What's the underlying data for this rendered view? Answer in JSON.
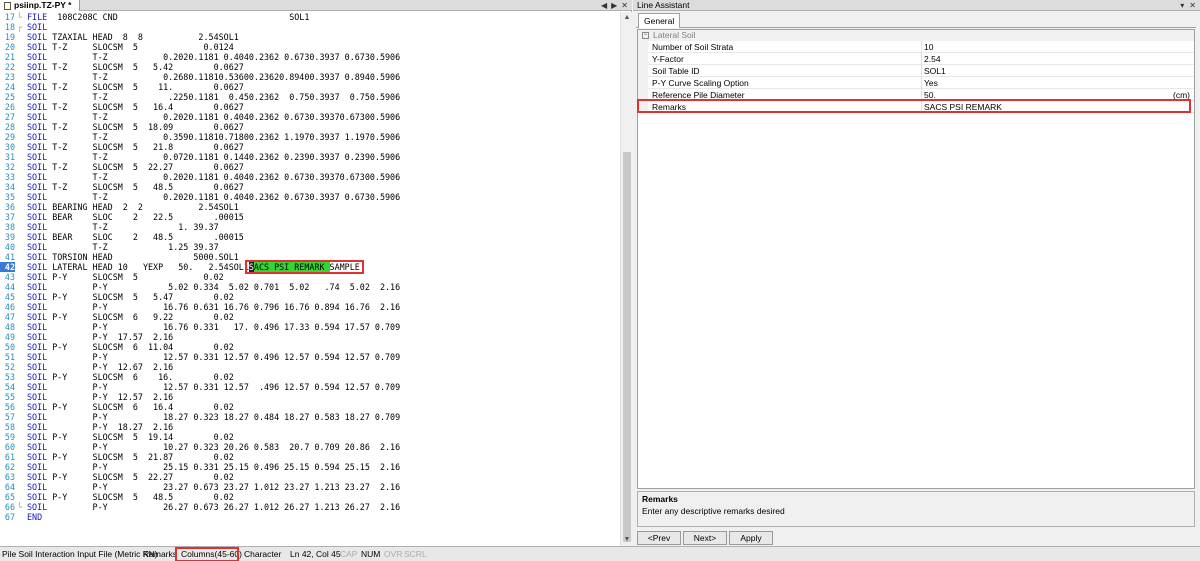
{
  "editor": {
    "tab_title": "psiinp.TZ-PY *",
    "tabbar_icons": [
      "◀",
      "▶",
      "✕"
    ],
    "lines": [
      {
        "n": "17",
        "fold": "└",
        "kw": "FILE",
        "rest": "  108C208C CND                                  SOL1"
      },
      {
        "n": "18",
        "fold": "┌",
        "kw": "SOIL",
        "rest": ""
      },
      {
        "n": "19",
        "fold": "",
        "kw": "SOIL",
        "rest": " TZAXIAL HEAD  8  8           2.54SOL1"
      },
      {
        "n": "20",
        "fold": "",
        "kw": "SOIL",
        "rest": " T-Z     SLOCSM  5             0.0124"
      },
      {
        "n": "21",
        "fold": "",
        "kw": "SOIL",
        "rest": "         T-Z           0.2020.1181 0.4040.2362 0.6730.3937 0.6730.5906"
      },
      {
        "n": "22",
        "fold": "",
        "kw": "SOIL",
        "rest": " T-Z     SLOCSM  5   5.42        0.0627"
      },
      {
        "n": "23",
        "fold": "",
        "kw": "SOIL",
        "rest": "         T-Z           0.2680.11810.53600.23620.89400.3937 0.8940.5906"
      },
      {
        "n": "24",
        "fold": "",
        "kw": "SOIL",
        "rest": " T-Z     SLOCSM  5    11.        0.0627"
      },
      {
        "n": "25",
        "fold": "",
        "kw": "SOIL",
        "rest": "         T-Z            .2250.1181  0.450.2362  0.750.3937  0.750.5906"
      },
      {
        "n": "26",
        "fold": "",
        "kw": "SOIL",
        "rest": " T-Z     SLOCSM  5   16.4        0.0627"
      },
      {
        "n": "27",
        "fold": "",
        "kw": "SOIL",
        "rest": "         T-Z           0.2020.1181 0.4040.2362 0.6730.39370.67300.5906"
      },
      {
        "n": "28",
        "fold": "",
        "kw": "SOIL",
        "rest": " T-Z     SLOCSM  5  18.09        0.0627"
      },
      {
        "n": "29",
        "fold": "",
        "kw": "SOIL",
        "rest": "         T-Z           0.3590.11810.71800.2362 1.1970.3937 1.1970.5906"
      },
      {
        "n": "30",
        "fold": "",
        "kw": "SOIL",
        "rest": " T-Z     SLOCSM  5   21.8        0.0627"
      },
      {
        "n": "31",
        "fold": "",
        "kw": "SOIL",
        "rest": "         T-Z           0.0720.1181 0.1440.2362 0.2390.3937 0.2390.5906"
      },
      {
        "n": "32",
        "fold": "",
        "kw": "SOIL",
        "rest": " T-Z     SLOCSM  5  22.27        0.0627"
      },
      {
        "n": "33",
        "fold": "",
        "kw": "SOIL",
        "rest": "         T-Z           0.2020.1181 0.4040.2362 0.6730.39370.67300.5906"
      },
      {
        "n": "34",
        "fold": "",
        "kw": "SOIL",
        "rest": " T-Z     SLOCSM  5   48.5        0.0627"
      },
      {
        "n": "35",
        "fold": "",
        "kw": "SOIL",
        "rest": "         T-Z           0.2020.1181 0.4040.2362 0.6730.3937 0.6730.5906"
      },
      {
        "n": "36",
        "fold": "",
        "kw": "SOIL",
        "rest": " BEARING HEAD  2  2           2.54SOL1"
      },
      {
        "n": "37",
        "fold": "",
        "kw": "SOIL",
        "rest": " BEAR    SLOC    2   22.5        .00015"
      },
      {
        "n": "38",
        "fold": "",
        "kw": "SOIL",
        "rest": "         T-Z              1. 39.37"
      },
      {
        "n": "39",
        "fold": "",
        "kw": "SOIL",
        "rest": " BEAR    SLOC    2   48.5        .00015"
      },
      {
        "n": "40",
        "fold": "",
        "kw": "SOIL",
        "rest": "         T-Z            1.25 39.37"
      },
      {
        "n": "41",
        "fold": "",
        "kw": "SOIL",
        "rest": " TORSION HEAD                5000.SOL1"
      },
      {
        "n": "42",
        "fold": "",
        "kw": "SOIL",
        "rest": " LATERAL HEAD 10   YEXP   50.   2.54SOL1",
        "current": true,
        "cursor": "S",
        "highlight": "ACS PSI REMARK ",
        "after": "SAMPLE"
      },
      {
        "n": "43",
        "fold": "",
        "kw": "SOIL",
        "rest": " P-Y     SLOCSM  5             0.02"
      },
      {
        "n": "44",
        "fold": "",
        "kw": "SOIL",
        "rest": "         P-Y            5.02 0.334  5.02 0.701  5.02   .74  5.02  2.16"
      },
      {
        "n": "45",
        "fold": "",
        "kw": "SOIL",
        "rest": " P-Y     SLOCSM  5   5.47        0.02"
      },
      {
        "n": "46",
        "fold": "",
        "kw": "SOIL",
        "rest": "         P-Y           16.76 0.631 16.76 0.796 16.76 0.894 16.76  2.16"
      },
      {
        "n": "47",
        "fold": "",
        "kw": "SOIL",
        "rest": " P-Y     SLOCSM  6   9.22        0.02"
      },
      {
        "n": "48",
        "fold": "",
        "kw": "SOIL",
        "rest": "         P-Y           16.76 0.331   17. 0.496 17.33 0.594 17.57 0.709"
      },
      {
        "n": "49",
        "fold": "",
        "kw": "SOIL",
        "rest": "         P-Y  17.57  2.16"
      },
      {
        "n": "50",
        "fold": "",
        "kw": "SOIL",
        "rest": " P-Y     SLOCSM  6  11.04        0.02"
      },
      {
        "n": "51",
        "fold": "",
        "kw": "SOIL",
        "rest": "         P-Y           12.57 0.331 12.57 0.496 12.57 0.594 12.57 0.709"
      },
      {
        "n": "52",
        "fold": "",
        "kw": "SOIL",
        "rest": "         P-Y  12.67  2.16"
      },
      {
        "n": "53",
        "fold": "",
        "kw": "SOIL",
        "rest": " P-Y     SLOCSM  6    16.        0.02"
      },
      {
        "n": "54",
        "fold": "",
        "kw": "SOIL",
        "rest": "         P-Y           12.57 0.331 12.57  .496 12.57 0.594 12.57 0.709"
      },
      {
        "n": "55",
        "fold": "",
        "kw": "SOIL",
        "rest": "         P-Y  12.57  2.16"
      },
      {
        "n": "56",
        "fold": "",
        "kw": "SOIL",
        "rest": " P-Y     SLOCSM  6   16.4        0.02"
      },
      {
        "n": "57",
        "fold": "",
        "kw": "SOIL",
        "rest": "         P-Y           18.27 0.323 18.27 0.484 18.27 0.583 18.27 0.709"
      },
      {
        "n": "58",
        "fold": "",
        "kw": "SOIL",
        "rest": "         P-Y  18.27  2.16"
      },
      {
        "n": "59",
        "fold": "",
        "kw": "SOIL",
        "rest": " P-Y     SLOCSM  5  19.14        0.02"
      },
      {
        "n": "60",
        "fold": "",
        "kw": "SOIL",
        "rest": "         P-Y           10.27 0.323 20.26 0.583  20.7 0.709 20.86  2.16"
      },
      {
        "n": "61",
        "fold": "",
        "kw": "SOIL",
        "rest": " P-Y     SLOCSM  5  21.87        0.02"
      },
      {
        "n": "62",
        "fold": "",
        "kw": "SOIL",
        "rest": "         P-Y           25.15 0.331 25.15 0.496 25.15 0.594 25.15  2.16"
      },
      {
        "n": "63",
        "fold": "",
        "kw": "SOIL",
        "rest": " P-Y     SLOCSM  5  22.27        0.02"
      },
      {
        "n": "64",
        "fold": "",
        "kw": "SOIL",
        "rest": "         P-Y           23.27 0.673 23.27 1.012 23.27 1.213 23.27  2.16"
      },
      {
        "n": "65",
        "fold": "",
        "kw": "SOIL",
        "rest": " P-Y     SLOCSM  5   48.5        0.02"
      },
      {
        "n": "66",
        "fold": "└",
        "kw": "SOIL",
        "rest": "         P-Y           26.27 0.673 26.27 1.012 26.27 1.213 26.27  2.16"
      },
      {
        "n": "67",
        "fold": "",
        "kw": "END",
        "rest": ""
      }
    ]
  },
  "line_assistant": {
    "title": "Line Assistant",
    "header_icons": [
      "▾",
      "✕"
    ],
    "tab_general": "General",
    "category": "Lateral Soil",
    "category_expander": "−",
    "properties": [
      {
        "name": "Number of Soil Strata",
        "value": "10",
        "unit": ""
      },
      {
        "name": "Y-Factor",
        "value": "2.54",
        "unit": ""
      },
      {
        "name": "Soil Table ID",
        "value": "SOL1",
        "unit": ""
      },
      {
        "name": "P-Y Curve Scaling Option",
        "value": "Yes",
        "unit": ""
      },
      {
        "name": "Reference Pile Diameter",
        "value": "50.",
        "unit": "(cm)"
      },
      {
        "name": "Remarks",
        "value": "SACS PSI REMARK",
        "unit": ""
      }
    ],
    "description": {
      "title": "Remarks",
      "text": "Enter any descriptive remarks desired"
    },
    "buttons": {
      "prev": "<Prev",
      "next": "Next>",
      "apply": "Apply"
    }
  },
  "status_bar": {
    "file_type": "Pile Soil Interaction Input File (Metric KN)",
    "field": "Remarks",
    "columns": "Columns(45-60)",
    "data_type": "Character",
    "position": "Ln 42, Col 45",
    "cap": "CAP",
    "num": "NUM",
    "ovr": "OVR",
    "scrl": "SCRL"
  },
  "colors": {
    "keyword": "#1717c6",
    "line_number": "#2b8cb8",
    "highlight": "#33d633",
    "annotation_box": "#e03030",
    "current_line_number_bg": "#3a78d6"
  }
}
